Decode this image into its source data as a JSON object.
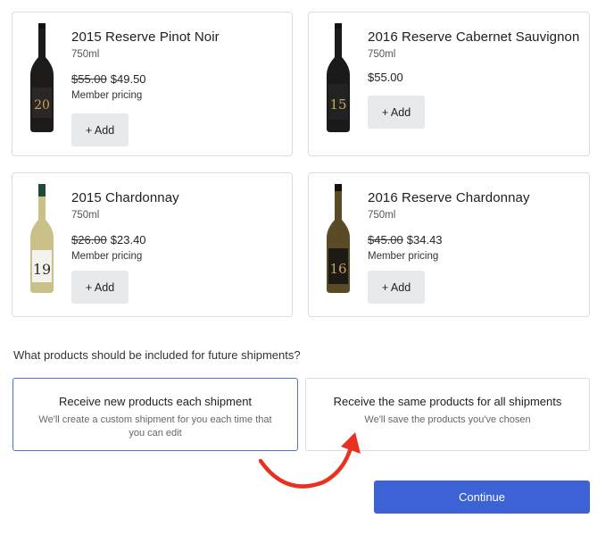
{
  "products": [
    {
      "name": "2015 Reserve Pinot Noir",
      "size": "750ml",
      "old_price": "$55.00",
      "price": "$49.50",
      "member": "Member pricing",
      "add": "+ Add",
      "label_num": "20",
      "glass": "#1c1b1a",
      "label": "#2a2724",
      "num_color": "#c8a35a"
    },
    {
      "name": "2016 Reserve Cabernet Sauvignon",
      "size": "750ml",
      "old_price": "",
      "price": "$55.00",
      "member": "",
      "add": "+ Add",
      "label_num": "15",
      "glass": "#1a1a1a",
      "label": "#222",
      "num_color": "#c8a35a"
    },
    {
      "name": "2015 Chardonnay",
      "size": "750ml",
      "old_price": "$26.00",
      "price": "$23.40",
      "member": "Member pricing",
      "add": "+ Add",
      "label_num": "19",
      "glass": "#c9c08a",
      "label": "#f4f2ec",
      "num_color": "#2b2b2b"
    },
    {
      "name": "2016 Reserve Chardonnay",
      "size": "750ml",
      "old_price": "$45.00",
      "price": "$34.43",
      "member": "Member pricing",
      "add": "+ Add",
      "label_num": "16",
      "glass": "#5a4a26",
      "label": "#1d1a15",
      "num_color": "#c8a35a"
    }
  ],
  "question": "What products should be included for future shipments?",
  "options": [
    {
      "title": "Receive new products each shipment",
      "desc": "We'll create a custom shipment for you each time that you can edit",
      "selected": true
    },
    {
      "title": "Receive the same products for all shipments",
      "desc": "We'll save the products you've chosen",
      "selected": false
    }
  ],
  "continue_label": "Continue",
  "colors": {
    "accent": "#3d62d6",
    "selected_border": "#4a72d9",
    "annotation_arrow": "#e8321f"
  },
  "icons": {
    "annotation": "curved-arrow-icon"
  }
}
